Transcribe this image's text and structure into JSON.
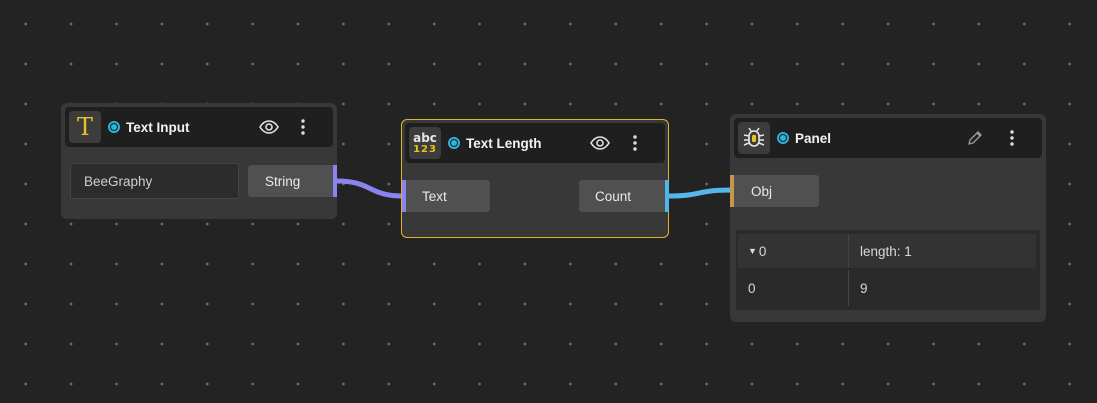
{
  "nodes": {
    "text_input": {
      "title": "Text Input",
      "icon": "text-type-icon",
      "value": "BeeGraphy",
      "output_label": "String",
      "output_color": "#8b84ee"
    },
    "text_length": {
      "title": "Text Length",
      "icon": "abc-123-icon",
      "icon_text_top": "abc",
      "icon_text_bottom": "123",
      "input_label": "Text",
      "output_label": "Count",
      "input_color": "#8b84ee",
      "output_color": "#4fb4e6"
    },
    "panel": {
      "title": "Panel",
      "icon": "bug-icon",
      "input_label": "Obj",
      "input_color": "#c8954a",
      "table": {
        "header_index": "0",
        "header_info": "length: 1",
        "rows": [
          {
            "index": "0",
            "value": "9"
          }
        ]
      }
    }
  },
  "colors": {
    "background": "#232323",
    "node": "#383838",
    "selected_border": "#e0b22c",
    "status": "#2cb3d9"
  }
}
